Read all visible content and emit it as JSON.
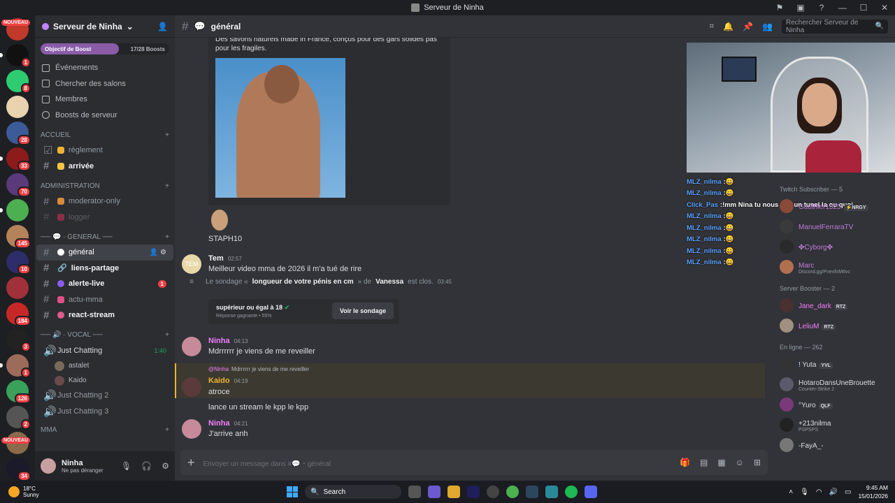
{
  "window": {
    "title": "Serveur de Ninha"
  },
  "guilds": {
    "nouveau_label": "NOUVEAU",
    "badges": [
      "1",
      "8",
      "",
      "28",
      "33",
      "70",
      "",
      "145",
      "10",
      "",
      "184",
      "3",
      "1",
      "126",
      "2",
      "",
      "34",
      ""
    ]
  },
  "sidebar": {
    "server_name": "Serveur de Ninha",
    "boost": {
      "label": "Objectif de Boost",
      "count": "17/28 Boosts",
      "progress": 0.61
    },
    "nav": [
      "Événements",
      "Chercher des salons",
      "Membres",
      "Boosts de serveur"
    ],
    "categories": {
      "accueil": "ACCUEIL",
      "admin": "ADMINISTRATION",
      "general": "── 💬 · GENERAL ──",
      "vocal": "── 🔊 · VOCAL ──",
      "mma": "MMA"
    },
    "channels": {
      "reglement": "règlement",
      "arrivee": "arrivée",
      "moderator": "moderator-only",
      "logger": "logger",
      "general": "général",
      "liens": "liens-partage",
      "alerte": "alerte-live",
      "alerte_mentions": "1",
      "actu": "actu-mma",
      "react": "react-stream"
    },
    "voice": {
      "just_chatting": "Just Chatting",
      "timer": "1:40",
      "users": [
        "astalet",
        "Kaido"
      ],
      "jc2": "Just Chatting 2",
      "jc3": "Just Chatting 3"
    }
  },
  "userbar": {
    "name": "Ninha",
    "status": "Ne pas déranger"
  },
  "channel_header": {
    "name": "général",
    "search_placeholder": "Rechercher Serveur de Ninha"
  },
  "messages": {
    "embed_desc": "Des savons naturels made in France, conçus pour des gars solides pas pour les fragiles.",
    "staph": "STAPH10",
    "tem": {
      "name": "Tem",
      "time": "02:57",
      "text": "Meilleur video mma de 2026 il m'a tué de rire",
      "avatar_text": "TEM"
    },
    "poll": {
      "prefix": "Le sondage «",
      "question": "longueur de votre pénis en cm",
      "mid": "» de",
      "author": "Vanessa",
      "suffix": "est clos.",
      "time": "03:45",
      "answer": "supérieur ou égal à 18",
      "result": "Réponse gagnante • 55%",
      "button": "Voir le sondage"
    },
    "ninha1": {
      "name": "Ninha",
      "time": "04:13",
      "text": "Mdrrrrrr je viens de me reveiller"
    },
    "reply": {
      "to": "@Ninha",
      "quote": "Mdrrrrrr je viens de me reveiller"
    },
    "kaido": {
      "name": "Kaido",
      "time": "04:19",
      "text1": "atroce",
      "text2": "lance un stream le kpp le kpp"
    },
    "ninha2": {
      "name": "Ninha",
      "time": "04:21",
      "text": "J'arrive anh"
    }
  },
  "composer": {
    "placeholder": "Envoyer un message dans #💬・général"
  },
  "stream_chat": [
    {
      "user": "MLZ_nilma",
      "msg": ":😄"
    },
    {
      "user": "MLZ_nilma",
      "msg": ":😄"
    },
    {
      "user": "Click_Pas",
      "msg": ":!mm Nina tu nous met un tunel la ou quoi"
    },
    {
      "user": "MLZ_nilma",
      "msg": ":😄"
    },
    {
      "user": "MLZ_nilma",
      "msg": ":😄"
    },
    {
      "user": "MLZ_nilma",
      "msg": ":😄"
    },
    {
      "user": "MLZ_nilma",
      "msg": ":😄"
    },
    {
      "user": "MLZ_nilma",
      "msg": ":😄"
    }
  ],
  "members": {
    "twitch_cat": "Twitch Subscriber — 5",
    "twitch": [
      {
        "name": "Gauthier1325",
        "tag": "⚡NRGY",
        "color": "#c27ad9"
      },
      {
        "name": "ManuelFerraraTV",
        "tag": "",
        "color": "#c27ad9"
      },
      {
        "name": "✤Cyborg✤",
        "tag": "",
        "color": "#c27ad9"
      },
      {
        "name": "Marc",
        "tag": "",
        "color": "#c27ad9",
        "sub": "Discord.gg/PnexfnM6vc"
      }
    ],
    "booster_cat": "Server Booster — 2",
    "boosters": [
      {
        "name": "Jane_dark",
        "tag": "RTZ",
        "color": "#f47fff"
      },
      {
        "name": "LeliuM",
        "tag": "RTZ",
        "color": "#f47fff"
      }
    ],
    "online_cat": "En ligne — 262",
    "online": [
      {
        "name": "! Yuta",
        "tag": "YVL",
        "color": "#dbdee1"
      },
      {
        "name": "HotaroDansUneBrouette",
        "tag": "",
        "color": "#dbdee1",
        "sub": "Counter-Strike 2"
      },
      {
        "name": "°Yuro",
        "tag": "QLF",
        "color": "#dbdee1"
      },
      {
        "name": "+213nilma",
        "tag": "",
        "color": "#dbdee1",
        "sub": "PSPSPS"
      },
      {
        "name": "-FayA_-",
        "tag": "",
        "color": "#dbdee1"
      }
    ]
  },
  "taskbar": {
    "temp": "18°C",
    "weather": "Sunny",
    "search": "Search",
    "time": "9:45 AM",
    "date": "15/01/2026"
  },
  "colors": {
    "accent": "#5865f2",
    "ninha": "#f47fff",
    "kaido": "#f0b232",
    "tem": "#f2f3f5"
  }
}
